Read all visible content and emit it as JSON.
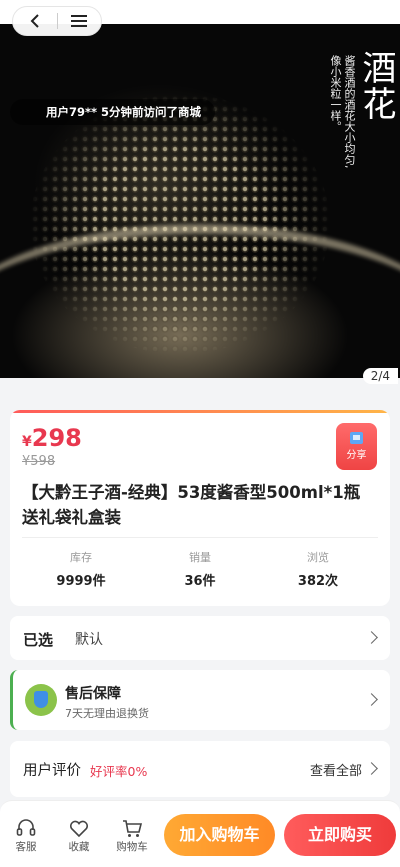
{
  "hero": {
    "title": "酒花",
    "subtitle_lines": [
      "酱香酒的酒花大小均匀,",
      "像小米粒一样。"
    ],
    "counter": "2/4",
    "visit_toast": "用户79** 5分钟前访问了商城"
  },
  "product": {
    "currency": "¥",
    "price": "298",
    "original_price": "¥598",
    "share_label": "分享",
    "title": "【大黔王子酒-经典】53度酱香型500ml*1瓶送礼袋礼盒装",
    "stats": [
      {
        "label": "库存",
        "value": "9999件"
      },
      {
        "label": "销量",
        "value": "36件"
      },
      {
        "label": "浏览",
        "value": "382次"
      }
    ]
  },
  "spec": {
    "label": "已选",
    "value": "默认"
  },
  "service": {
    "title": "售后保障",
    "desc": "7天无理由退换货"
  },
  "reviews": {
    "label": "用户评价",
    "rate": "好评率0%",
    "view_all": "查看全部"
  },
  "bottom": {
    "tabs": [
      {
        "icon": "headset-icon",
        "label": "客服"
      },
      {
        "icon": "heart-icon",
        "label": "收藏"
      },
      {
        "icon": "cart-icon",
        "label": "购物车"
      }
    ],
    "add_cart": "加入购物车",
    "buy_now": "立即购买"
  },
  "colors": {
    "accent": "#e8384f",
    "cart": "#ff9a2e",
    "buy": "#ef3b3b",
    "service_border": "#4caf50"
  }
}
